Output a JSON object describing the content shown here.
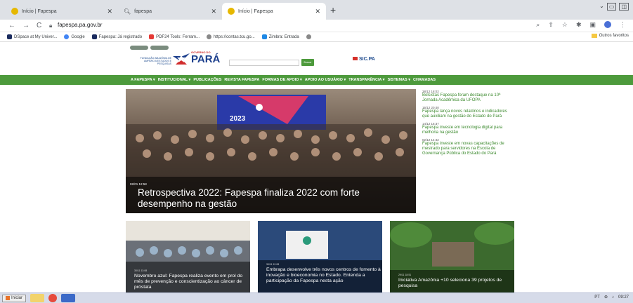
{
  "browser": {
    "tabs": [
      {
        "title": "Início | Fapespa",
        "active": false
      },
      {
        "title": "fapespa",
        "active": false
      },
      {
        "title": "Início | Fapespa",
        "active": true
      }
    ],
    "new_tab": "+",
    "url": "fapespa.pa.gov.br",
    "bookmarks": [
      {
        "label": "DSpace at My Univer...",
        "icon": "dspace-icon"
      },
      {
        "label": "Google",
        "icon": "google-icon"
      },
      {
        "label": "Fapespa: Já registrado",
        "icon": "dspace-icon"
      },
      {
        "label": "PDF24 Tools: Ferram...",
        "icon": "pdf24-icon"
      },
      {
        "label": "https://contas.tcu.go...",
        "icon": "globe-icon"
      },
      {
        "label": "Zimbra: Entrada",
        "icon": "zimbra-icon"
      },
      {
        "label": "",
        "icon": "globe-icon"
      }
    ],
    "other_bookmarks": "Outros favoritos"
  },
  "site": {
    "logo_text": "PARÁ",
    "gov_text": "GOVERNO DO",
    "fapespa_text": "FUNDAÇÃO AMAZÔNIA DE AMPARO A ESTUDOS E PESQUISAS",
    "search_button": "Buscar",
    "sic_label": "SIC.PA",
    "nav": [
      "A FAPESPA ▾",
      "INSTITUCIONAL ▾",
      "PUBLICAÇÕES",
      "REVISTA FAPESPA",
      "FORMAS DE APOIO ▾",
      "APOIO AO USUÁRIO ▾",
      "TRANSPARÊNCIA ▾",
      "SISTEMAS ▾",
      "CHAMADAS"
    ]
  },
  "hero": {
    "date": "02/01 12:58",
    "title": "Retrospectiva 2022: Fapespa finaliza 2022 com forte desempenho na gestão",
    "banner_text": "2023"
  },
  "side_news": [
    {
      "date": "28/12 18:02",
      "title": "Bolsistas Fapespa foram destaque na 10ª Jornada Acadêmica da UFOPA"
    },
    {
      "date": "16/12 20:40",
      "title": "Fapespa lança novos relatórios e indicadores que auxiliam na gestão do Estado do Pará"
    },
    {
      "date": "14/12 16:37",
      "title": "Fapespa investe em tecnologia digital para melhoria na gestão"
    },
    {
      "date": "02/12 14:42",
      "title": "Fapespa investe em novas capacitações de mestrado para servidores na Escola de Governança Pública do Estado do Pará"
    }
  ],
  "cards": [
    {
      "date": "30/11 13:08",
      "title": "Novembro azul: Fapespa realiza evento em prol do mês de prevenção e conscientização ao câncer de próstata"
    },
    {
      "date": "30/11 12:08",
      "title": "Embrapa desenvolve três novos centros de fomento à inovação e bioeconomia no Estado. Entenda a participação da Fapespa nesta ação"
    },
    {
      "date": "29/11 18:51",
      "title": "Iniciativa Amazônia +10 seleciona 39 projetos de pesquisa"
    }
  ],
  "taskbar": {
    "start": "Iniciar",
    "lang": "PT",
    "time": "09:27"
  }
}
